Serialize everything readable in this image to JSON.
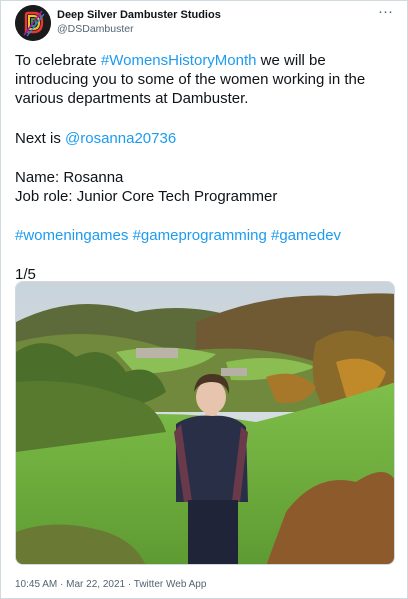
{
  "account": {
    "display_name": "Deep Silver Dambuster Studios",
    "handle": "@DSDambuster",
    "more_label": "···"
  },
  "tweet": {
    "line1_prefix": "To celebrate ",
    "line1_hashtag": "#WomensHistoryMonth",
    "line1_suffix": " we will be introducing you to some of the women working in the various departments at Dambuster.",
    "next_prefix": "Next is ",
    "next_mention": "@rosanna20736",
    "name_line": "Name: Rosanna",
    "role_line": "Job role: Junior Core Tech Programmer",
    "hashtags": [
      "#womeningames",
      "#gameprogramming",
      "#gamedev"
    ],
    "counter": "1/5"
  },
  "footer": {
    "timestamp": "10:45 AM · Mar 22, 2021 · Twitter Web App"
  },
  "colors": {
    "link": "#1d9bf0",
    "text": "#0f1419",
    "secondary": "#536471"
  },
  "icons": {
    "avatar": "dambuster-logo-icon",
    "more": "more-options-icon"
  }
}
